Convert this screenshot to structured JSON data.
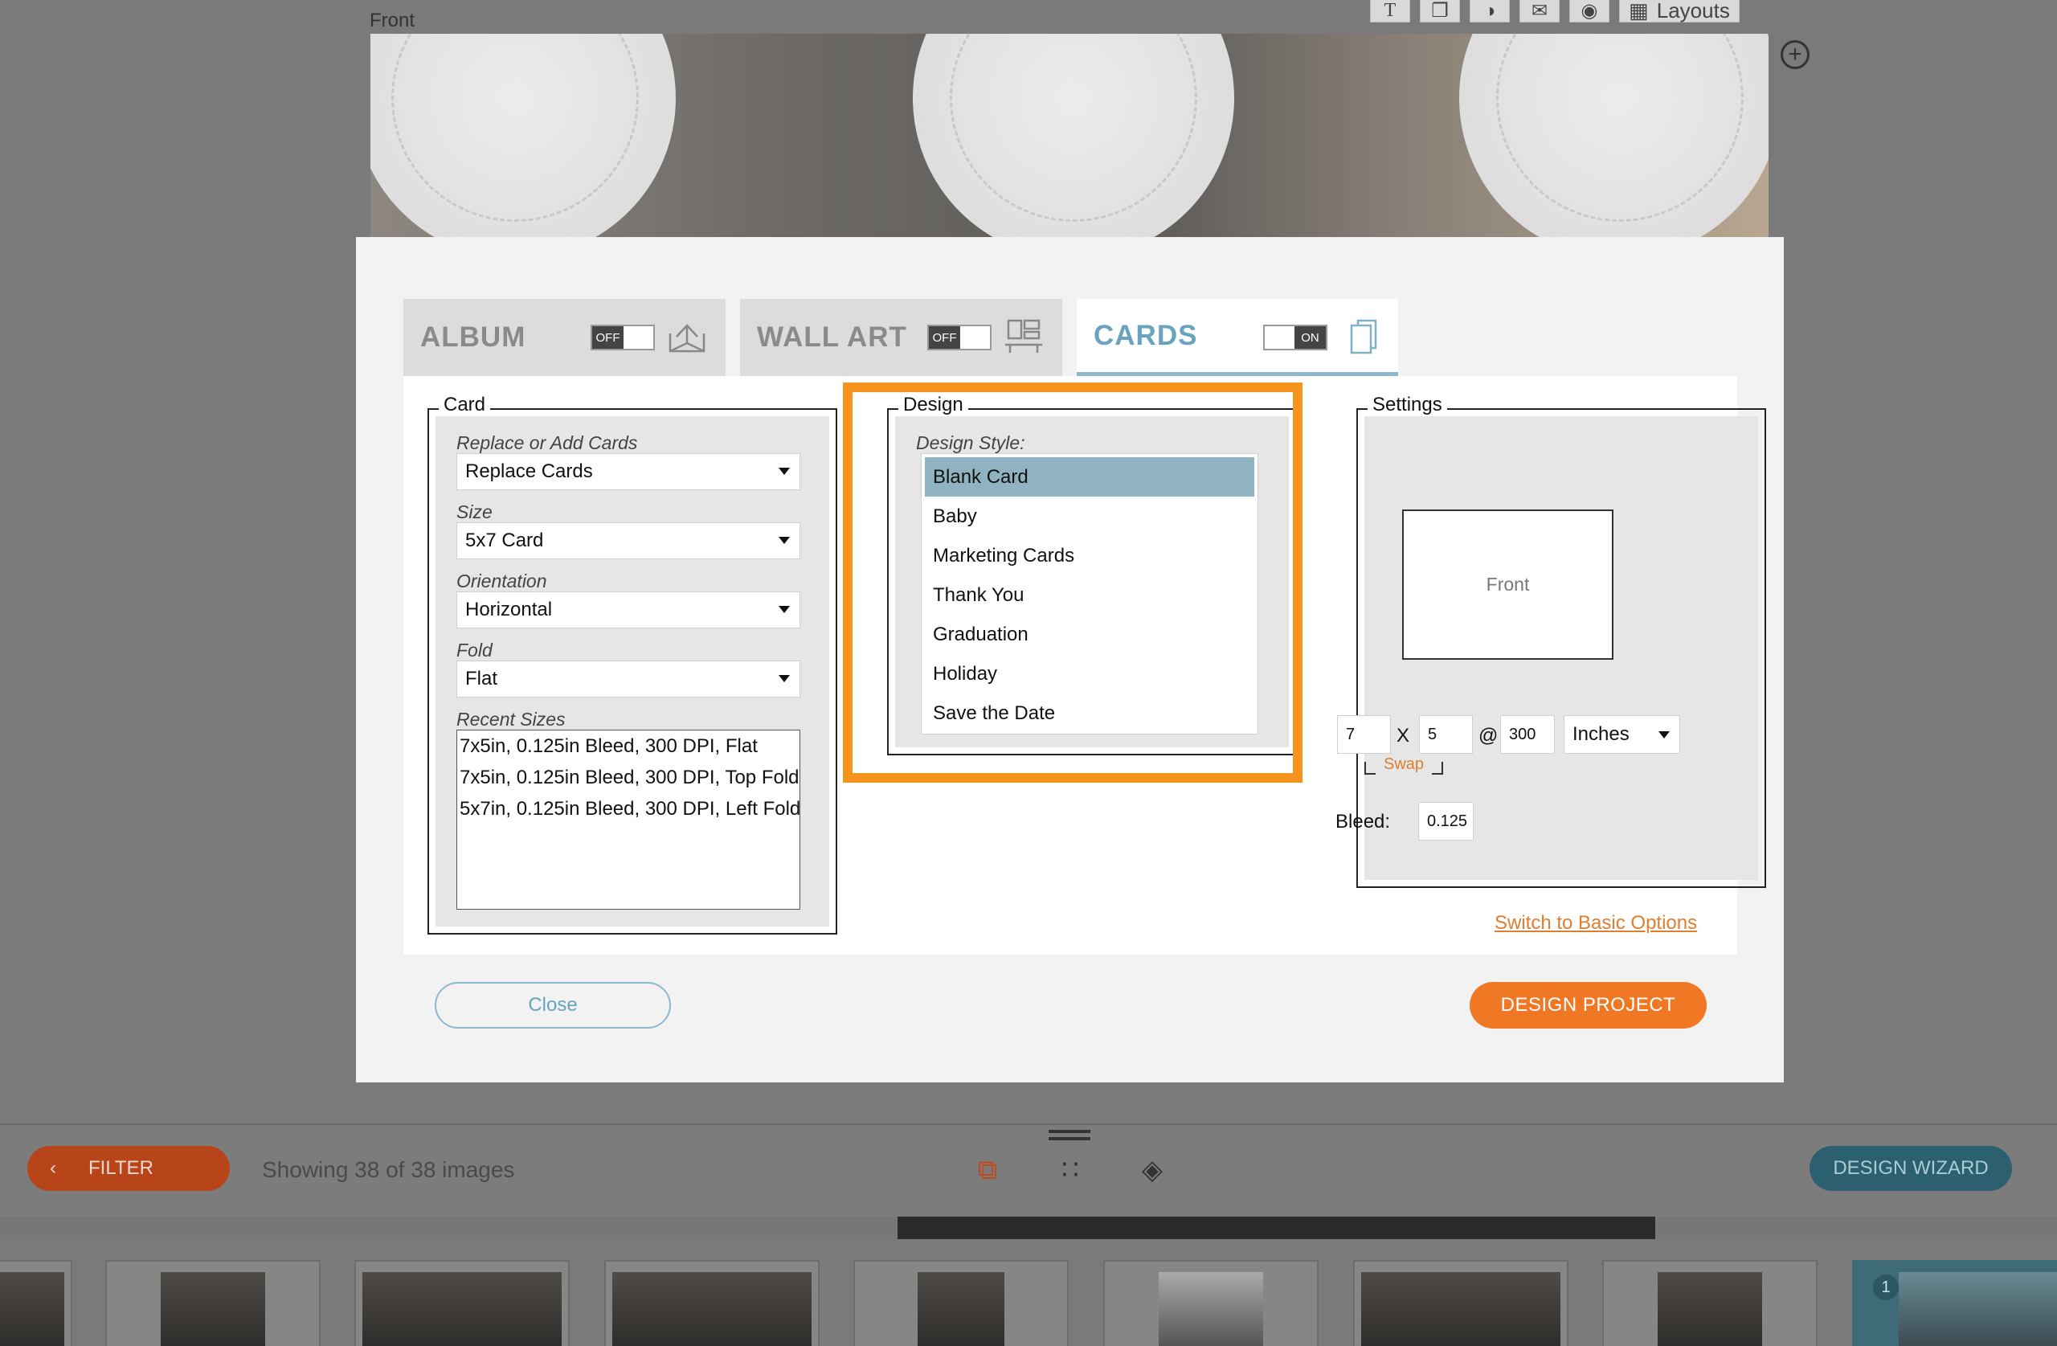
{
  "background": {
    "front_label": "Front",
    "toolbar": {
      "text_icon": "T",
      "layouts_label": "Layouts"
    },
    "bottom_bar": {
      "filter_label": "FILTER",
      "showing_text": "Showing 38 of 38 images",
      "design_wizard_label": "DESIGN WIZARD"
    },
    "selected_thumb_badge": "1"
  },
  "modal": {
    "tabs": [
      {
        "label": "ALBUM",
        "toggle": "OFF",
        "icon": "album-icon"
      },
      {
        "label": "WALL ART",
        "toggle": "OFF",
        "icon": "wall-art-icon"
      },
      {
        "label": "CARDS",
        "toggle": "ON",
        "icon": "cards-icon"
      }
    ],
    "card": {
      "title": "Card",
      "replace_label": "Replace or Add Cards",
      "replace_value": "Replace Cards",
      "size_label": "Size",
      "size_value": "5x7 Card",
      "orientation_label": "Orientation",
      "orientation_value": "Horizontal",
      "fold_label": "Fold",
      "fold_value": "Flat",
      "recent_label": "Recent Sizes",
      "recent_sizes": [
        "7x5in, 0.125in Bleed, 300 DPI, Flat",
        "7x5in, 0.125in Bleed, 300 DPI, Top Fold",
        "5x7in, 0.125in Bleed, 300 DPI, Left Fold"
      ]
    },
    "design": {
      "title": "Design",
      "style_label": "Design Style:",
      "styles": [
        "Blank Card",
        "Baby",
        "Marketing Cards",
        "Thank You",
        "Graduation",
        "Holiday",
        "Save the Date"
      ],
      "selected_style": "Blank Card"
    },
    "settings": {
      "title": "Settings",
      "preview_label": "Front",
      "width": "7",
      "x_symbol": "X",
      "height": "5",
      "at_symbol": "@",
      "dpi": "300",
      "units": "Inches",
      "swap_label": "Swap",
      "bleed_label": "Bleed:",
      "bleed_value": "0.125"
    },
    "switch_link": "Switch to Basic Options",
    "close_label": "Close",
    "design_project_label": "DESIGN PROJECT"
  },
  "colors": {
    "accent_orange": "#f07825",
    "highlight_orange": "#f7941d",
    "accent_blue": "#6aa3bd",
    "selected_item": "#8fb3c0"
  }
}
